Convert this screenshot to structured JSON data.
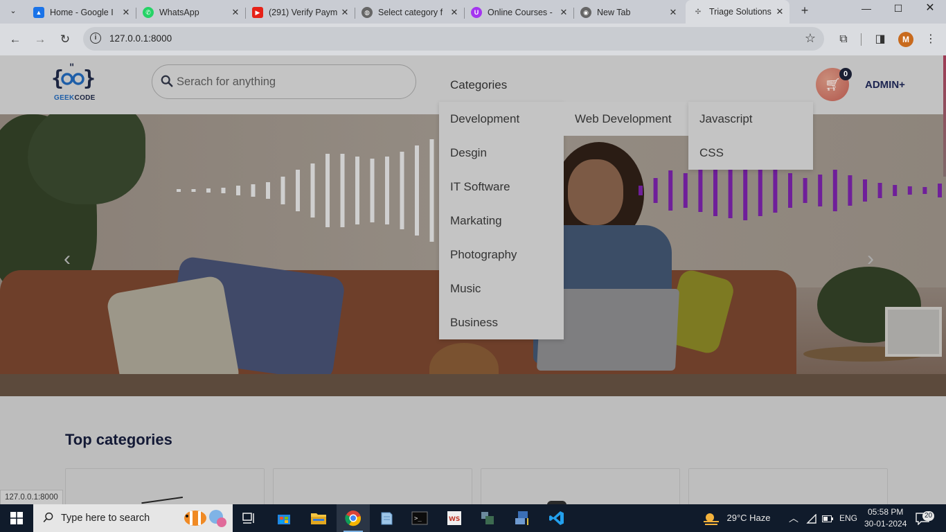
{
  "browser": {
    "tabs": [
      {
        "title": "Home - Google I",
        "favicon": "google-drive-icon",
        "fav_color": "#1a73e8"
      },
      {
        "title": "WhatsApp",
        "favicon": "whatsapp-icon",
        "fav_color": "#25d366"
      },
      {
        "title": "(291) Verify Paym",
        "favicon": "youtube-icon",
        "fav_color": "#e62117"
      },
      {
        "title": "Select category f",
        "favicon": "globe-icon",
        "fav_color": "#555555"
      },
      {
        "title": "Online Courses -",
        "favicon": "udemy-icon",
        "fav_color": "#a435f0"
      },
      {
        "title": "New Tab",
        "favicon": "chrome-icon",
        "fav_color": "#555555"
      },
      {
        "title": "Triage Solutions",
        "favicon": "django-icon",
        "fav_color": "#7a7a7a"
      }
    ],
    "url": "127.0.0.1:8000",
    "profile_initial": "M",
    "status_url": "127.0.0.1:8000"
  },
  "site": {
    "logo_braces": "{ⁿ͡ⁿ}",
    "logo_text_a": "GEEK",
    "logo_text_b": "CODE",
    "search_placeholder": "Serach for anything",
    "categories_label": "Categories",
    "cart_count": "0",
    "admin_label": "ADMIN+",
    "menu_level1": [
      "Development",
      "Desgin",
      "IT Software",
      "Markating",
      "Photography",
      "Music",
      "Business"
    ],
    "menu_level2": [
      "Web Development"
    ],
    "menu_level3": [
      "Javascript",
      "CSS"
    ],
    "top_categories_title": "Top categories"
  },
  "taskbar": {
    "search_text": "Type here to search",
    "weather": "29°C  Haze",
    "language": "ENG",
    "time": "05:58 PM",
    "date": "30-01-2024",
    "notifications": "20"
  },
  "colors": {
    "accent_cart": "#b2574d",
    "brand_navy": "#1c2450",
    "wave_purple": "#6f1f9a",
    "wave_white": "#cfcfcf"
  }
}
